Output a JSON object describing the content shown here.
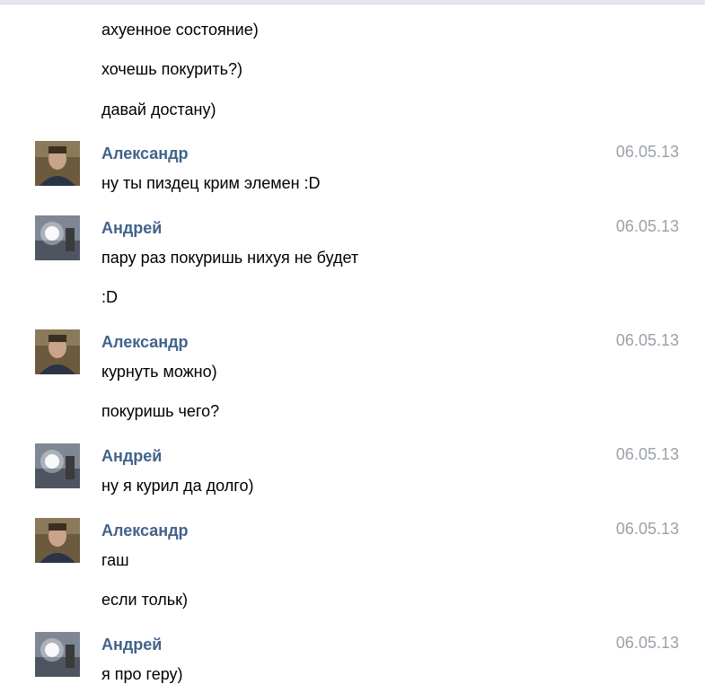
{
  "messages": [
    {
      "type": "continuation",
      "text": "ахуенное состояние)"
    },
    {
      "type": "continuation",
      "text": "хочешь покурить?)"
    },
    {
      "type": "continuation",
      "text": "давай достану)"
    },
    {
      "type": "header",
      "author": "Александр",
      "date": "06.05.13",
      "avatar": "alexander-photo"
    },
    {
      "type": "continuation",
      "text": "ну ты пиздец крим элемен :D"
    },
    {
      "type": "header",
      "author": "Андрей",
      "date": "06.05.13",
      "avatar": "andrey-photo"
    },
    {
      "type": "continuation",
      "text": "пару раз покуришь нихуя не будет"
    },
    {
      "type": "continuation",
      "text": ":D"
    },
    {
      "type": "header",
      "author": "Александр",
      "date": "06.05.13",
      "avatar": "alexander-photo"
    },
    {
      "type": "continuation",
      "text": "курнуть можно)"
    },
    {
      "type": "continuation",
      "text": "покуришь чего?"
    },
    {
      "type": "header",
      "author": "Андрей",
      "date": "06.05.13",
      "avatar": "andrey-photo"
    },
    {
      "type": "continuation",
      "text": "ну я курил да долго)"
    },
    {
      "type": "header",
      "author": "Александр",
      "date": "06.05.13",
      "avatar": "alexander-photo"
    },
    {
      "type": "continuation",
      "text": "гаш"
    },
    {
      "type": "continuation",
      "text": "если тольк)"
    },
    {
      "type": "header",
      "author": "Андрей",
      "date": "06.05.13",
      "avatar": "andrey-photo"
    },
    {
      "type": "continuation",
      "text": "я про геру)"
    }
  ]
}
